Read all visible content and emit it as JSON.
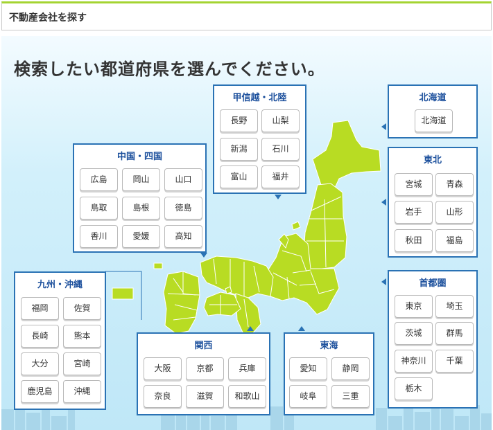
{
  "header": {
    "title": "不動産会社を探す"
  },
  "main": {
    "heading": "検索したい都道府県を選んでください。"
  },
  "regions": {
    "hokkaido": {
      "title": "北海道",
      "prefs": [
        "北海道"
      ]
    },
    "tohoku": {
      "title": "東北",
      "prefs": [
        "宮城",
        "青森",
        "岩手",
        "山形",
        "秋田",
        "福島"
      ]
    },
    "shutoken": {
      "title": "首都圏",
      "prefs": [
        "東京",
        "埼玉",
        "茨城",
        "群馬",
        "神奈川",
        "千葉",
        "栃木"
      ]
    },
    "koshinetsu": {
      "title": "甲信越・北陸",
      "prefs": [
        "長野",
        "山梨",
        "新潟",
        "石川",
        "富山",
        "福井"
      ]
    },
    "chugoku": {
      "title": "中国・四国",
      "prefs": [
        "広島",
        "岡山",
        "山口",
        "鳥取",
        "島根",
        "徳島",
        "香川",
        "愛媛",
        "高知"
      ]
    },
    "kyushu": {
      "title": "九州・沖縄",
      "prefs": [
        "福岡",
        "佐賀",
        "長崎",
        "熊本",
        "大分",
        "宮崎",
        "鹿児島",
        "沖縄"
      ]
    },
    "kansai": {
      "title": "関西",
      "prefs": [
        "大阪",
        "京都",
        "兵庫",
        "奈良",
        "滋賀",
        "和歌山"
      ]
    },
    "tokai": {
      "title": "東海",
      "prefs": [
        "愛知",
        "静岡",
        "岐阜",
        "三重"
      ]
    }
  },
  "colors": {
    "map_green": "#b8dc23",
    "border_blue": "#2a72b4",
    "title_blue": "#1b4f9c",
    "accent_green": "#a4d431"
  }
}
